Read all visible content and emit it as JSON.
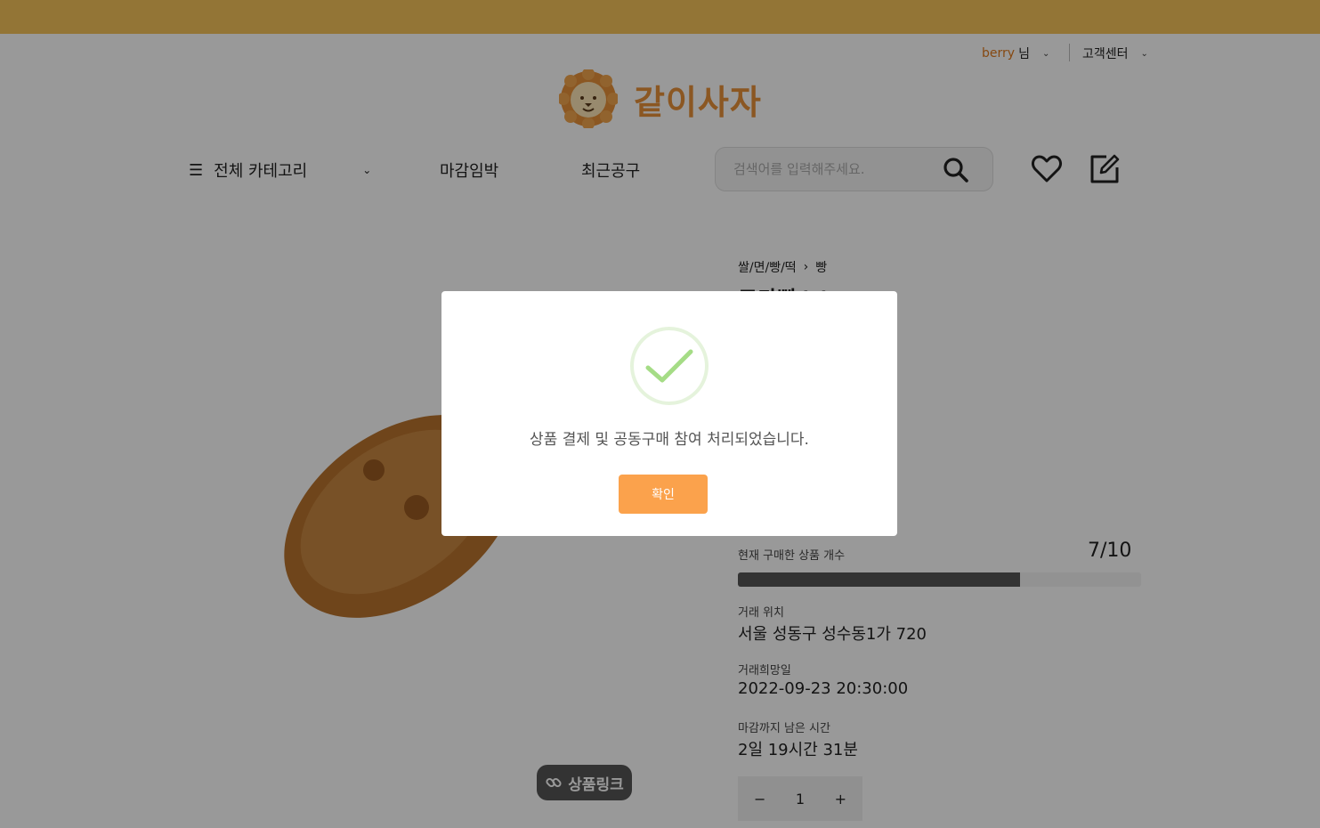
{
  "header": {
    "username": "berry",
    "user_suffix": "님",
    "customer_center": "고객센터",
    "logo_text": "같이사자"
  },
  "nav": {
    "all_categories": "전체 카테고리",
    "deadline": "마감임박",
    "recent": "최근공구"
  },
  "search": {
    "placeholder": "검색어를 입력해주세요."
  },
  "product": {
    "category": "쌀/면/빵/떡",
    "subcategory": "빵",
    "title": "모카빵^^",
    "count_label": "현재 구매한 상품 개수",
    "count_value": "7/10",
    "progress_fraction": 0.7,
    "location_label": "거래 위치",
    "location_value": "서울 성동구 성수동1가 720",
    "date_label": "거래희망일",
    "date_value": "2022-09-23 20:30:00",
    "remaining_label": "마감까지 남은 시간",
    "remaining_value": "2일 19시간 31분",
    "quantity": "1",
    "minus": "−",
    "plus": "+",
    "link_chip": "상품링크"
  },
  "modal": {
    "message": "상품 결제 및 공동구매 참여 처리되었습니다.",
    "confirm": "확인"
  },
  "colors": {
    "topbar": "#f6c45a",
    "accent": "#e8913a",
    "button": "#fba24c",
    "check": "#a5dc86"
  }
}
